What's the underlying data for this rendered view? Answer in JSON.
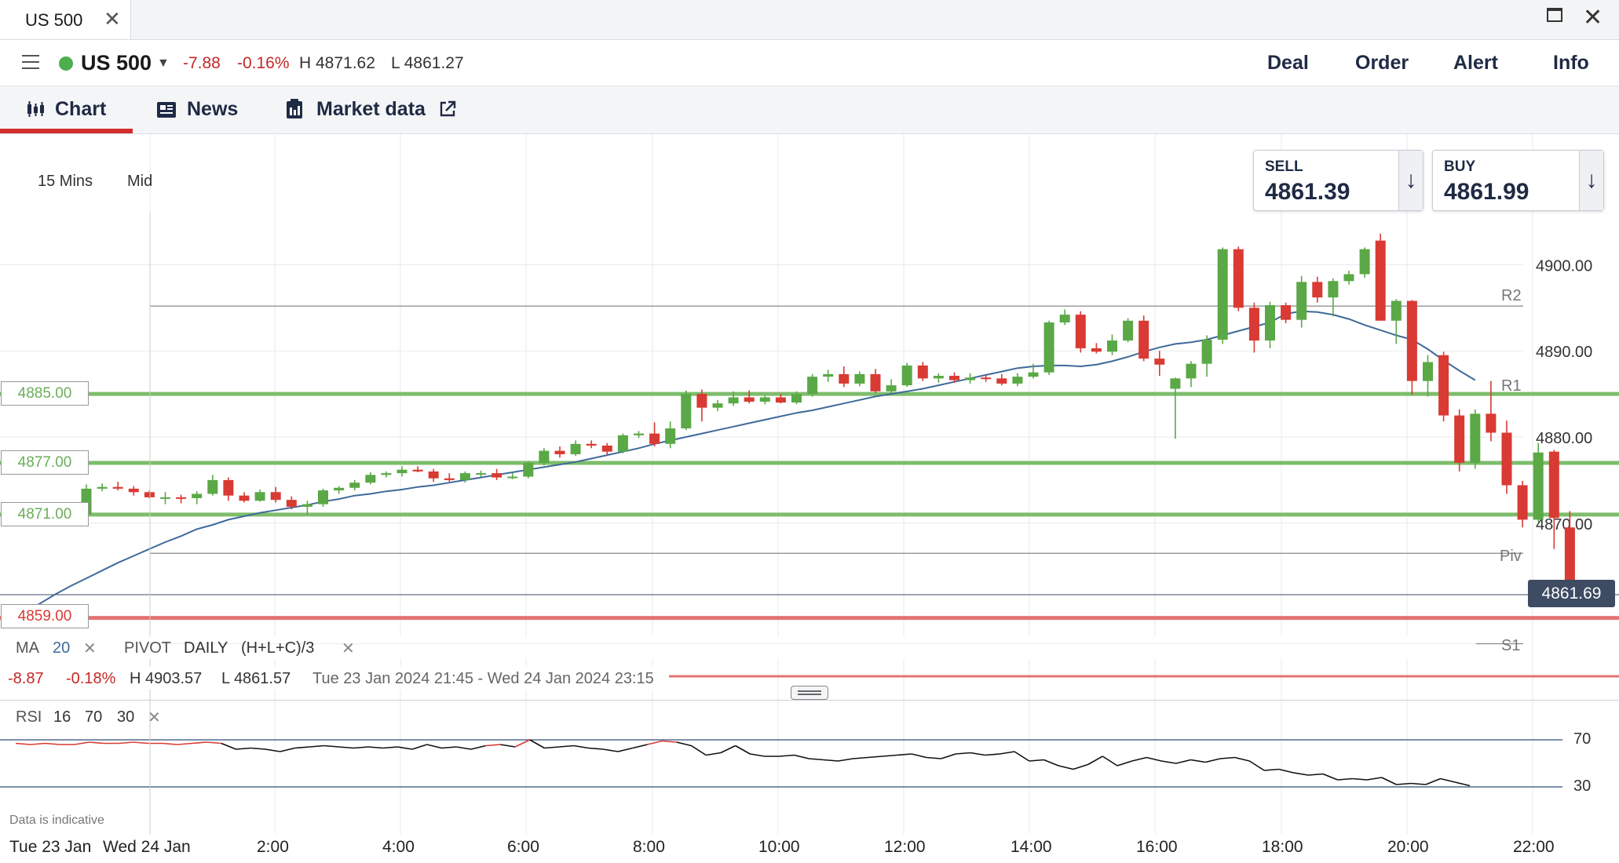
{
  "window": {
    "tab_title": "US 500",
    "close_glyph": "✕",
    "close_window_glyph": "✕"
  },
  "instrument": {
    "name": "US 500",
    "change_abs": "-7.88",
    "change_pct": "-0.16%",
    "high": "H 4871.62",
    "low": "L 4861.27",
    "status_color": "#4caf50"
  },
  "actions": [
    "Deal",
    "Order",
    "Alert",
    "Info"
  ],
  "tabs": {
    "chart": "Chart",
    "news": "News",
    "market_data": "Market data"
  },
  "chart_controls": {
    "timeframe": "15 Mins",
    "price_mode": "Mid"
  },
  "quote": {
    "sell_label": "SELL",
    "sell_price": "4861.39",
    "buy_label": "BUY",
    "buy_price": "4861.99",
    "arrow": "↓"
  },
  "levels": {
    "hline_1": "4885.00",
    "hline_2": "4877.00",
    "hline_3": "4871.00",
    "hline_4": "4859.00",
    "current_price": "4861.69",
    "pivot_labels": [
      "R2",
      "R1",
      "Piv",
      "S1"
    ]
  },
  "indicators": {
    "ma_label": "MA",
    "ma_period": "20",
    "pivot_label": "PIVOT",
    "pivot_period": "DAILY",
    "pivot_formula": "(H+L+C)/3",
    "remove_glyph": "✕"
  },
  "range_summary": {
    "change_abs": "-8.87",
    "change_pct": "-0.18%",
    "high": "H 4903.57",
    "low": "L 4861.57",
    "period": "Tue 23 Jan 2024 21:45 - Wed 24 Jan 2024 23:15"
  },
  "rsi": {
    "label": "RSI",
    "period": "16",
    "upper": "70",
    "lower": "30"
  },
  "footer_note": "Data is indicative",
  "colors": {
    "up": "#5aa846",
    "down": "#d93a33",
    "accent": "#d32f2f",
    "ma": "#3f6a9a",
    "hline": "#7ebd6b",
    "hline_red": "#e57373"
  },
  "chart_data": {
    "type": "candlestick",
    "instrument": "US 500",
    "interval": "15 Mins",
    "price_axis": {
      "ticks": [
        4900,
        4890,
        4880,
        4870
      ],
      "labels": [
        "4900.00",
        "4890.00",
        "4880.00",
        "4870.00"
      ]
    },
    "time_axis": {
      "labels": [
        "Tue 23 Jan",
        "Wed 24 Jan",
        "2:00",
        "4:00",
        "6:00",
        "8:00",
        "10:00",
        "12:00",
        "14:00",
        "16:00",
        "18:00",
        "20:00",
        "22:00"
      ]
    },
    "horizontal_levels": [
      4885.0,
      4877.0,
      4871.0,
      4859.0
    ],
    "pivots": {
      "R2": 4895.2,
      "R1": 4885.0,
      "Piv": 4866.5,
      "S1": 4856.0
    },
    "current_price": 4861.69,
    "candles": [
      [
        4871.0,
        4874.5,
        4870.0,
        4874.0
      ],
      [
        4874.0,
        4874.6,
        4873.7,
        4874.2
      ],
      [
        4874.2,
        4874.8,
        4873.8,
        4874.0
      ],
      [
        4874.0,
        4874.3,
        4873.2,
        4873.6
      ],
      [
        4873.6,
        4873.8,
        4872.9,
        4873.0
      ],
      [
        4872.9,
        4873.6,
        4872.2,
        4873.0
      ],
      [
        4873.0,
        4873.3,
        4872.3,
        4872.9
      ],
      [
        4872.9,
        4873.7,
        4872.2,
        4873.4
      ],
      [
        4873.4,
        4875.6,
        4873.2,
        4875.0
      ],
      [
        4875.0,
        4875.3,
        4872.6,
        4873.2
      ],
      [
        4873.2,
        4873.6,
        4872.4,
        4872.6
      ],
      [
        4872.6,
        4873.9,
        4872.5,
        4873.6
      ],
      [
        4873.6,
        4874.2,
        4872.4,
        4872.7
      ],
      [
        4872.7,
        4873.1,
        4871.6,
        4871.9
      ],
      [
        4871.9,
        4872.6,
        4871.0,
        4872.2
      ],
      [
        4872.2,
        4874.0,
        4871.9,
        4873.8
      ],
      [
        4873.8,
        4874.3,
        4873.4,
        4874.1
      ],
      [
        4874.1,
        4875.0,
        4873.8,
        4874.7
      ],
      [
        4874.7,
        4875.9,
        4874.5,
        4875.6
      ],
      [
        4875.6,
        4876.0,
        4875.3,
        4875.8
      ],
      [
        4875.8,
        4876.6,
        4875.4,
        4876.2
      ],
      [
        4876.2,
        4876.6,
        4875.9,
        4876.0
      ],
      [
        4876.0,
        4876.3,
        4874.8,
        4875.2
      ],
      [
        4875.2,
        4875.8,
        4874.8,
        4875.0
      ],
      [
        4875.0,
        4876.0,
        4874.7,
        4875.8
      ],
      [
        4875.8,
        4876.1,
        4875.4,
        4875.8
      ],
      [
        4875.8,
        4876.3,
        4875.0,
        4875.3
      ],
      [
        4875.3,
        4875.8,
        4875.1,
        4875.4
      ],
      [
        4875.4,
        4877.2,
        4875.2,
        4877.0
      ],
      [
        4877.0,
        4878.7,
        4876.7,
        4878.4
      ],
      [
        4878.4,
        4878.9,
        4877.6,
        4878.0
      ],
      [
        4878.0,
        4879.6,
        4877.8,
        4879.2
      ],
      [
        4879.2,
        4879.6,
        4878.7,
        4879.0
      ],
      [
        4879.0,
        4879.3,
        4877.9,
        4878.3
      ],
      [
        4878.3,
        4880.4,
        4878.1,
        4880.2
      ],
      [
        4880.2,
        4880.7,
        4879.9,
        4880.4
      ],
      [
        4880.4,
        4881.7,
        4878.9,
        4879.2
      ],
      [
        4879.2,
        4881.8,
        4878.7,
        4881.0
      ],
      [
        4881.0,
        4885.4,
        4880.8,
        4885.0
      ],
      [
        4885.0,
        4885.5,
        4881.8,
        4883.4
      ],
      [
        4883.4,
        4884.3,
        4883.0,
        4883.9
      ],
      [
        4883.9,
        4885.3,
        4883.6,
        4884.6
      ],
      [
        4884.6,
        4885.4,
        4883.9,
        4884.1
      ],
      [
        4884.1,
        4884.8,
        4883.8,
        4884.6
      ],
      [
        4884.6,
        4885.0,
        4883.9,
        4884.0
      ],
      [
        4884.0,
        4885.3,
        4883.8,
        4885.0
      ],
      [
        4885.0,
        4887.3,
        4884.7,
        4887.0
      ],
      [
        4887.0,
        4887.8,
        4886.4,
        4887.3
      ],
      [
        4887.3,
        4888.2,
        4885.8,
        4886.2
      ],
      [
        4886.2,
        4887.6,
        4885.9,
        4887.3
      ],
      [
        4887.3,
        4887.9,
        4885.1,
        4885.3
      ],
      [
        4885.3,
        4886.7,
        4885.1,
        4886.0
      ],
      [
        4886.0,
        4888.6,
        4885.8,
        4888.3
      ],
      [
        4888.3,
        4888.7,
        4886.5,
        4886.8
      ],
      [
        4886.8,
        4887.4,
        4886.3,
        4887.1
      ],
      [
        4887.1,
        4887.5,
        4886.3,
        4886.6
      ],
      [
        4886.6,
        4887.4,
        4886.2,
        4886.9
      ],
      [
        4886.9,
        4887.2,
        4886.4,
        4886.8
      ],
      [
        4886.8,
        4887.3,
        4886.0,
        4886.2
      ],
      [
        4886.2,
        4887.4,
        4885.9,
        4887.0
      ],
      [
        4887.0,
        4888.5,
        4886.8,
        4887.5
      ],
      [
        4887.5,
        4893.5,
        4887.2,
        4893.3
      ],
      [
        4893.3,
        4894.8,
        4893.0,
        4894.2
      ],
      [
        4894.2,
        4894.6,
        4889.8,
        4890.3
      ],
      [
        4890.3,
        4890.9,
        4889.7,
        4889.9
      ],
      [
        4889.9,
        4891.9,
        4889.5,
        4891.2
      ],
      [
        4891.2,
        4893.8,
        4891.0,
        4893.5
      ],
      [
        4893.5,
        4894.1,
        4888.8,
        4889.1
      ],
      [
        4889.1,
        4890.0,
        4887.1,
        4888.4
      ],
      [
        4885.6,
        4886.9,
        4879.8,
        4886.8
      ],
      [
        4886.8,
        4888.8,
        4885.8,
        4888.5
      ],
      [
        4888.5,
        4891.8,
        4887.0,
        4891.3
      ],
      [
        4891.3,
        4902.0,
        4890.8,
        4901.8
      ],
      [
        4901.8,
        4902.1,
        4894.6,
        4895.0
      ],
      [
        4895.0,
        4895.6,
        4889.8,
        4891.2
      ],
      [
        4891.2,
        4895.7,
        4890.3,
        4895.3
      ],
      [
        4895.3,
        4895.6,
        4893.2,
        4893.6
      ],
      [
        4893.6,
        4898.7,
        4892.7,
        4898.0
      ],
      [
        4898.0,
        4898.6,
        4895.6,
        4896.2
      ],
      [
        4896.2,
        4898.4,
        4894.0,
        4898.1
      ],
      [
        4898.1,
        4899.3,
        4897.7,
        4898.9
      ],
      [
        4898.9,
        4902.0,
        4898.5,
        4901.8
      ],
      [
        4902.8,
        4903.6,
        4894.1,
        4893.5
      ],
      [
        4893.5,
        4896.0,
        4890.8,
        4895.8
      ],
      [
        4895.8,
        4895.9,
        4884.9,
        4886.5
      ],
      [
        4886.5,
        4889.5,
        4884.7,
        4888.7
      ],
      [
        4889.5,
        4889.9,
        4881.8,
        4882.5
      ],
      [
        4882.5,
        4883.2,
        4876.0,
        4877.0
      ],
      [
        4877.0,
        4883.2,
        4876.3,
        4882.7
      ],
      [
        4882.7,
        4886.5,
        4879.5,
        4880.5
      ],
      [
        4880.5,
        4881.9,
        4873.4,
        4874.4
      ],
      [
        4874.4,
        4874.9,
        4869.5,
        4870.4
      ],
      [
        4870.4,
        4879.3,
        4870.1,
        4878.2
      ],
      [
        4878.3,
        4878.5,
        4867.0,
        4870.6
      ],
      [
        4869.5,
        4871.4,
        4861.6,
        4861.7
      ]
    ],
    "ma20": [
      4858.6,
      4859.6,
      4860.6,
      4861.7,
      4862.7,
      4863.6,
      4864.5,
      4865.4,
      4866.2,
      4867.0,
      4867.8,
      4868.5,
      4869.3,
      4869.8,
      4870.4,
      4870.8,
      4871.2,
      4871.5,
      4871.8,
      4872.1,
      4872.5,
      4872.8,
      4873.2,
      4873.4,
      4873.7,
      4873.9,
      4874.2,
      4874.4,
      4874.7,
      4875.0,
      4875.3,
      4875.6,
      4875.9,
      4876.2,
      4876.5,
      4876.8,
      4877.1,
      4877.5,
      4877.9,
      4878.3,
      4878.7,
      4879.2,
      4879.6,
      4880.0,
      4880.4,
      4880.8,
      4881.2,
      4881.6,
      4882.0,
      4882.4,
      4882.8,
      4883.1,
      4883.5,
      4883.9,
      4884.3,
      4884.7,
      4885.0,
      4885.3,
      4885.6,
      4886.0,
      4886.4,
      4886.8,
      4887.2,
      4887.6,
      4888.0,
      4888.2,
      4888.3,
      4888.3,
      4888.2,
      4888.4,
      4888.8,
      4889.3,
      4889.9,
      4890.4,
      4890.8,
      4891.0,
      4891.3,
      4891.8,
      4892.3,
      4892.8,
      4893.3,
      4894.3,
      4894.6,
      4894.5,
      4894.2,
      4893.7,
      4893.0,
      4892.4,
      4891.8,
      4891.3,
      4890.2,
      4888.9,
      4887.7,
      4886.6
    ],
    "rsi": [
      67,
      66,
      67,
      66,
      66,
      68,
      67,
      67,
      68,
      67,
      67,
      66,
      67,
      68,
      67,
      62,
      63,
      62,
      60,
      63,
      64,
      65,
      64,
      63,
      64,
      63,
      64,
      62,
      66,
      63,
      64,
      62,
      65,
      66,
      64,
      70,
      63,
      64,
      65,
      63,
      62,
      60,
      63,
      66,
      69,
      68,
      65,
      57,
      59,
      65,
      58,
      56,
      56,
      57,
      54,
      53,
      52,
      54,
      55,
      56,
      57,
      58,
      55,
      54,
      58,
      59,
      57,
      58,
      60,
      52,
      53,
      48,
      45,
      49,
      56,
      48,
      52,
      55,
      52,
      50,
      53,
      51,
      54,
      55,
      52,
      44,
      45,
      42,
      40,
      41,
      36,
      37,
      36,
      38,
      32,
      33,
      32,
      37,
      34,
      31
    ],
    "rsi_levels": [
      70,
      30
    ]
  }
}
